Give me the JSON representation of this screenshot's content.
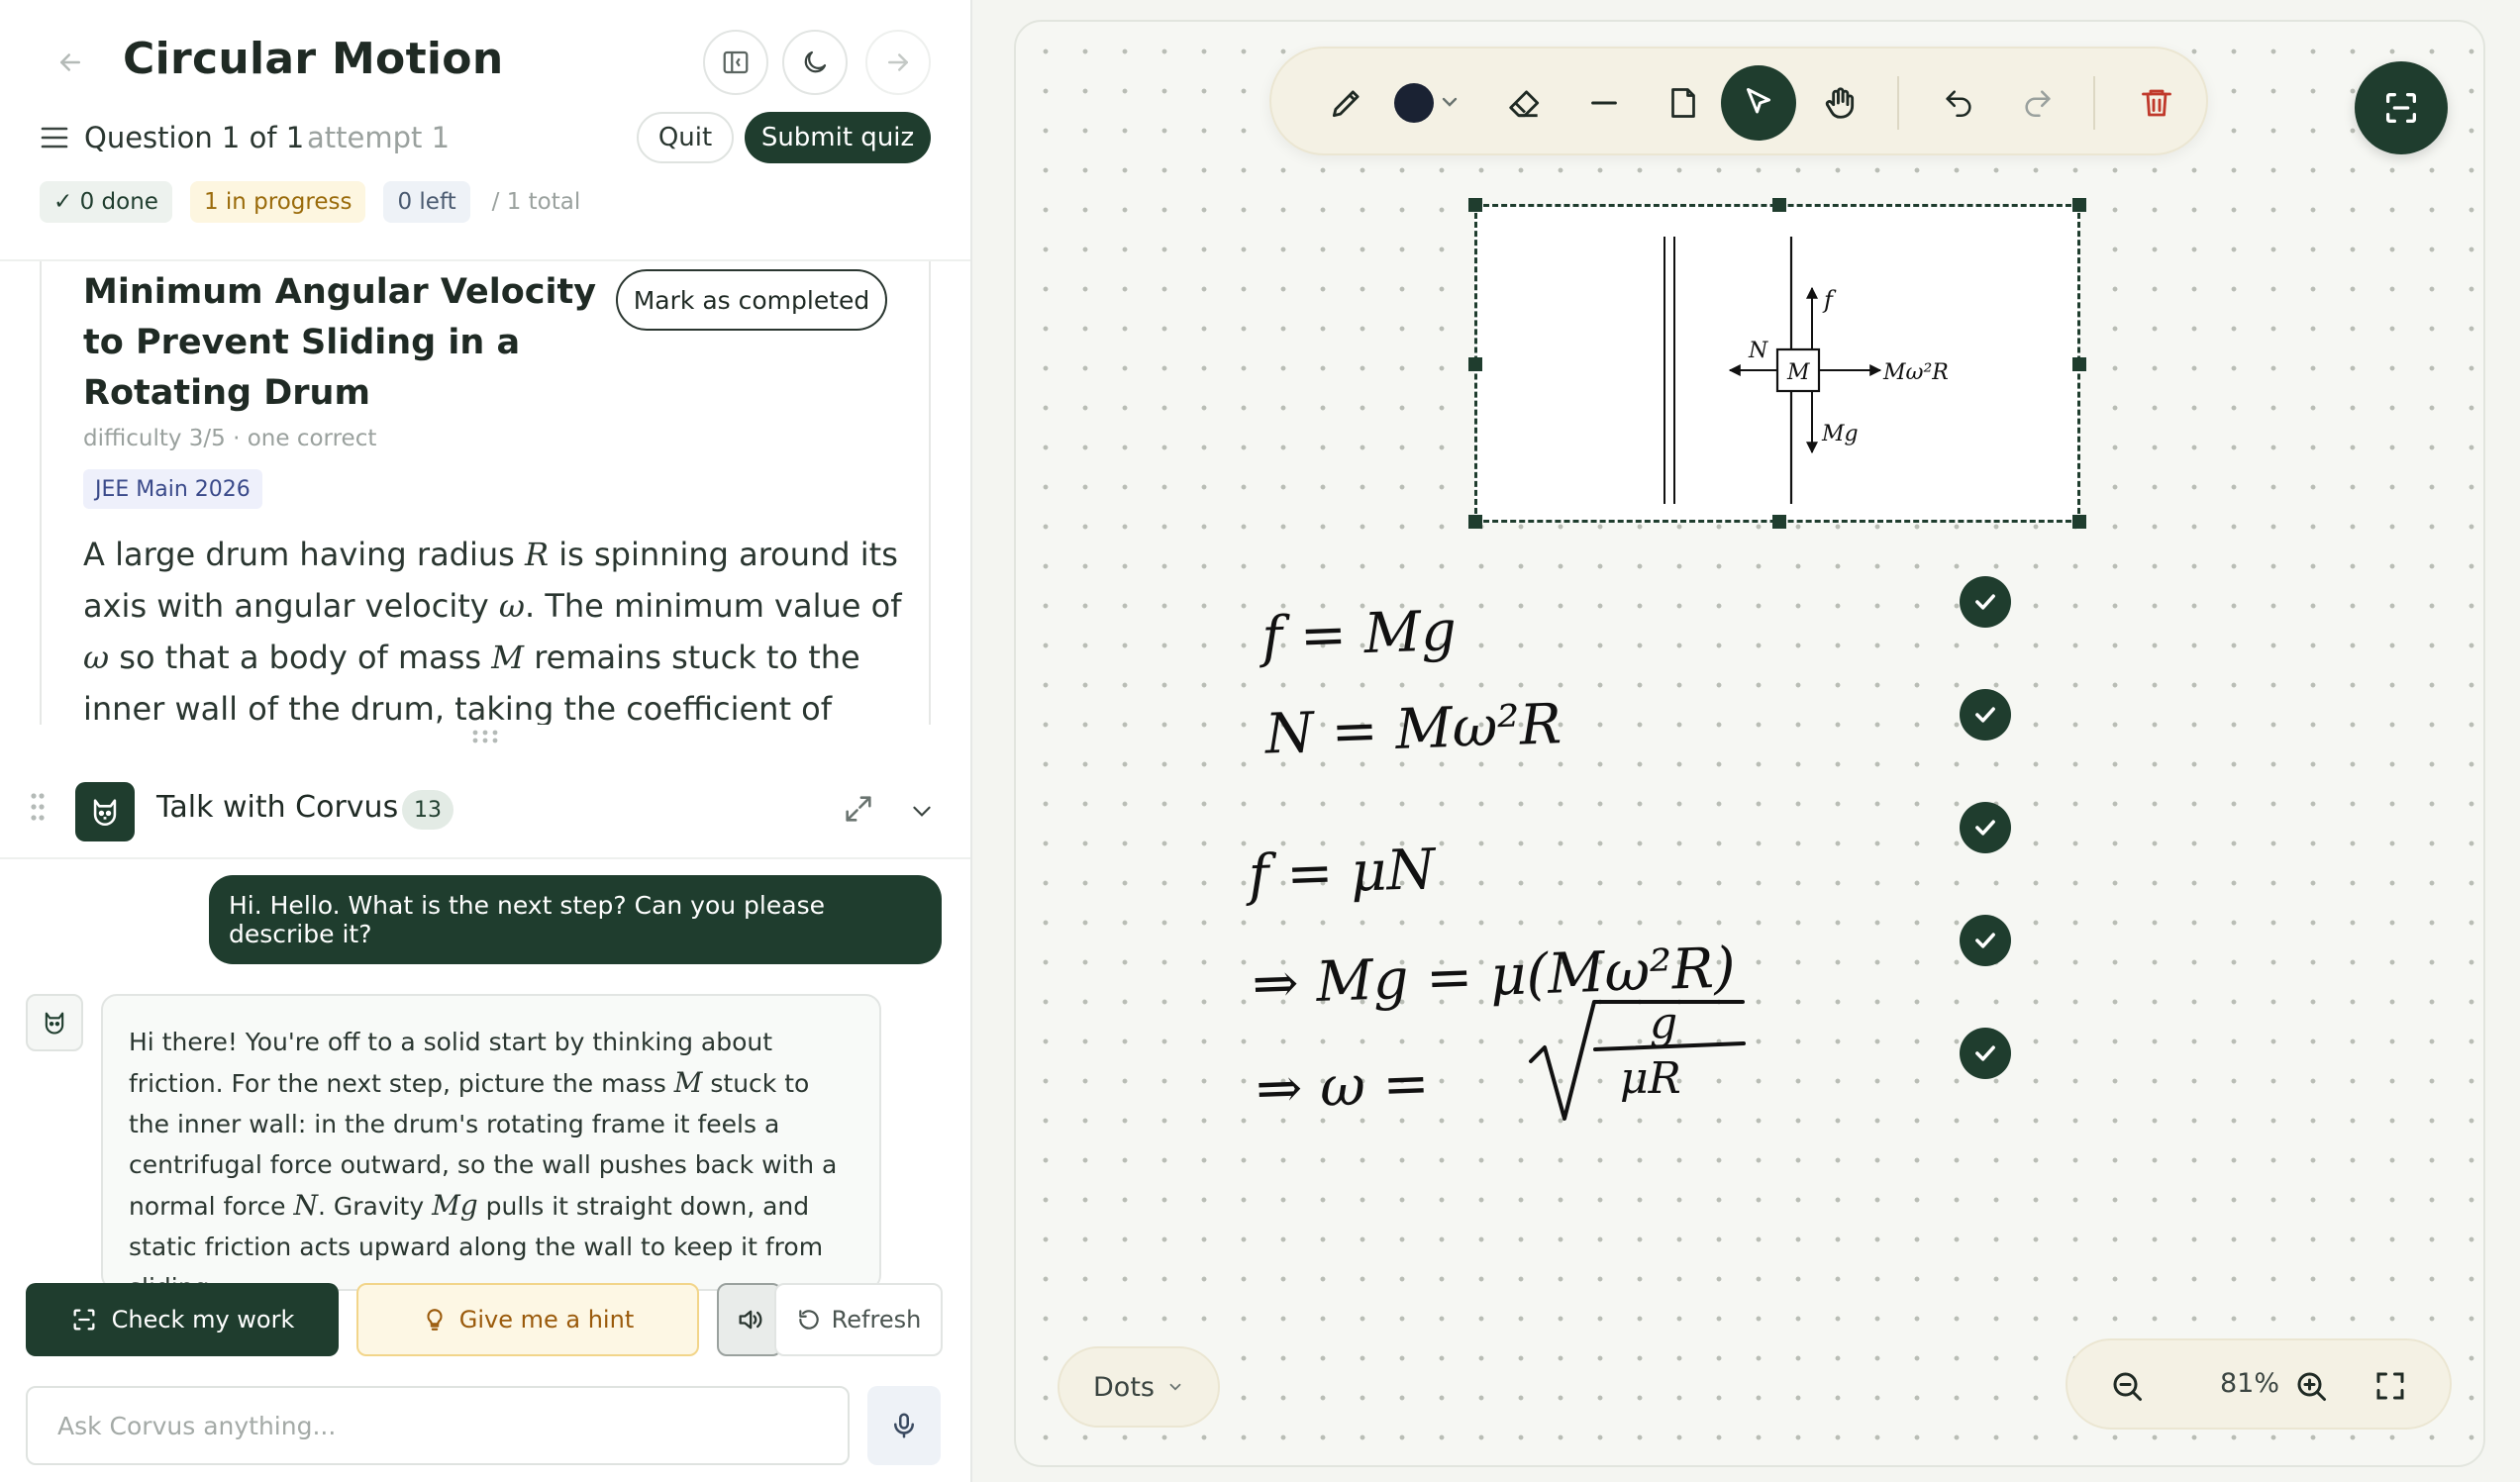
{
  "header": {
    "title": "Circular Motion",
    "question_counter": "Question 1 of 1",
    "attempt": "attempt 1",
    "quit_label": "Quit",
    "submit_label": "Submit quiz"
  },
  "progress": {
    "done": "✓ 0 done",
    "in_progress": "1 in progress",
    "left": "0 left",
    "total": "/ 1 total"
  },
  "question": {
    "title": "Minimum Angular Velocity to Prevent Sliding in a Rotating Drum",
    "mark_label": "Mark as completed",
    "meta": "difficulty 3/5 · one correct",
    "tag": "JEE Main 2026",
    "body_1": "A large drum having radius ",
    "var_R": "R",
    "body_2": " is spinning around its axis with angular velocity ",
    "var_w": "ω",
    "body_3": ". The minimum value of ",
    "body_4": " so that a body of mass ",
    "var_M": "M",
    "body_5": " remains stuck to the inner wall of the drum, taking the coefficient of friction between the drum"
  },
  "chat": {
    "title": "Talk with Corvus",
    "count": "13",
    "user_message": "Hi. Hello. What is the next step? Can you please describe it?",
    "bot_1": "Hi there! You're off to a solid start by thinking about friction. For the next step, picture the mass ",
    "bot_var_M": "M",
    "bot_2": " stuck to the inner wall: in the drum's rotating frame it feels a centrifugal force outward, so the wall pushes back with a normal force ",
    "bot_var_N": "N",
    "bot_3": ". Gravity ",
    "bot_var_Mg": "Mg",
    "bot_4": " pulls it straight down, and static friction acts upward along the wall to keep it from sliding.",
    "check_label": "Check my work",
    "hint_label": "Give me a hint",
    "refresh_label": "Refresh",
    "input_placeholder": "Ask Corvus anything..."
  },
  "canvas": {
    "diagram": {
      "label_f": "f",
      "label_N": "N",
      "label_M": "M",
      "label_Mw2R": "Mω²R",
      "label_Mg": "Mg"
    },
    "handwriting": {
      "line1": "f = Mg",
      "line2": "N = Mω²R",
      "line3": "f = μN",
      "line4": "⇒ Mg = μ(Mω²R)",
      "line5_lhs": "⇒ ω =",
      "line5_num": "g",
      "line5_den": "μR"
    },
    "background_mode": "Dots",
    "zoom": "81%"
  },
  "colors": {
    "brand": "#1f3d2e",
    "delete": "#c0392b",
    "hint_bg": "#fdf7e4",
    "ink": "#111111"
  },
  "icons": {
    "toolbar": [
      "pencil-icon",
      "color-swatch",
      "eraser-icon",
      "line-icon",
      "sticky-note-icon",
      "pointer-icon",
      "hand-icon",
      "undo-icon",
      "redo-icon",
      "trash-icon"
    ]
  }
}
